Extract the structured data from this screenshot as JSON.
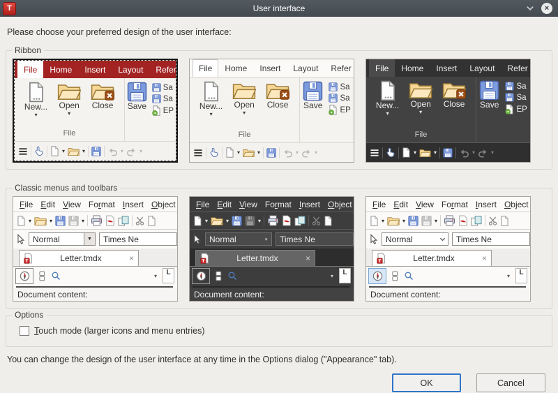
{
  "titlebar": {
    "title": "User interface",
    "app_icon_letter": "T"
  },
  "intro": "Please choose your preferred design of the user interface:",
  "ribbon_group": {
    "label": "Ribbon"
  },
  "classic_group": {
    "label": "Classic menus and toolbars"
  },
  "options_group": {
    "label": "Options",
    "touch_mode": {
      "mn": "T",
      "rest": "ouch mode (larger icons and menu entries)",
      "checked": false
    }
  },
  "ribbon_preview": {
    "tabs": [
      "File",
      "Home",
      "Insert",
      "Layout",
      "Refer"
    ],
    "active_tab": "File",
    "buttons": {
      "new": "New...",
      "open": "Open",
      "close": "Close",
      "save": "Save"
    },
    "small_buttons": [
      "Sa",
      "Sa",
      "EP"
    ],
    "group_label": "File",
    "selected_index": 0
  },
  "classic_preview": {
    "menus": [
      {
        "pre": "",
        "mn": "F",
        "post": "ile"
      },
      {
        "pre": "",
        "mn": "E",
        "post": "dit"
      },
      {
        "pre": "",
        "mn": "V",
        "post": "iew"
      },
      {
        "pre": "Fo",
        "mn": "r",
        "post": "mat"
      },
      {
        "pre": "",
        "mn": "I",
        "post": "nsert"
      },
      {
        "pre": "",
        "mn": "O",
        "post": "bject"
      }
    ],
    "paragraph_style": "Normal",
    "font_name": "Times Ne",
    "document_tab": "Letter.tmdx",
    "content_label": "Document content:",
    "right_panel_letter": "L"
  },
  "footer_note": "You can change the design of the user interface at any time in the Options dialog (\"Appearance\" tab).",
  "buttons": {
    "ok": "OK",
    "cancel": "Cancel"
  },
  "colors": {
    "accent_red": "#a32323",
    "titlebar": "#4a5157",
    "ok_border": "#2e75c8",
    "dialog_bg": "#f0eeeb"
  }
}
